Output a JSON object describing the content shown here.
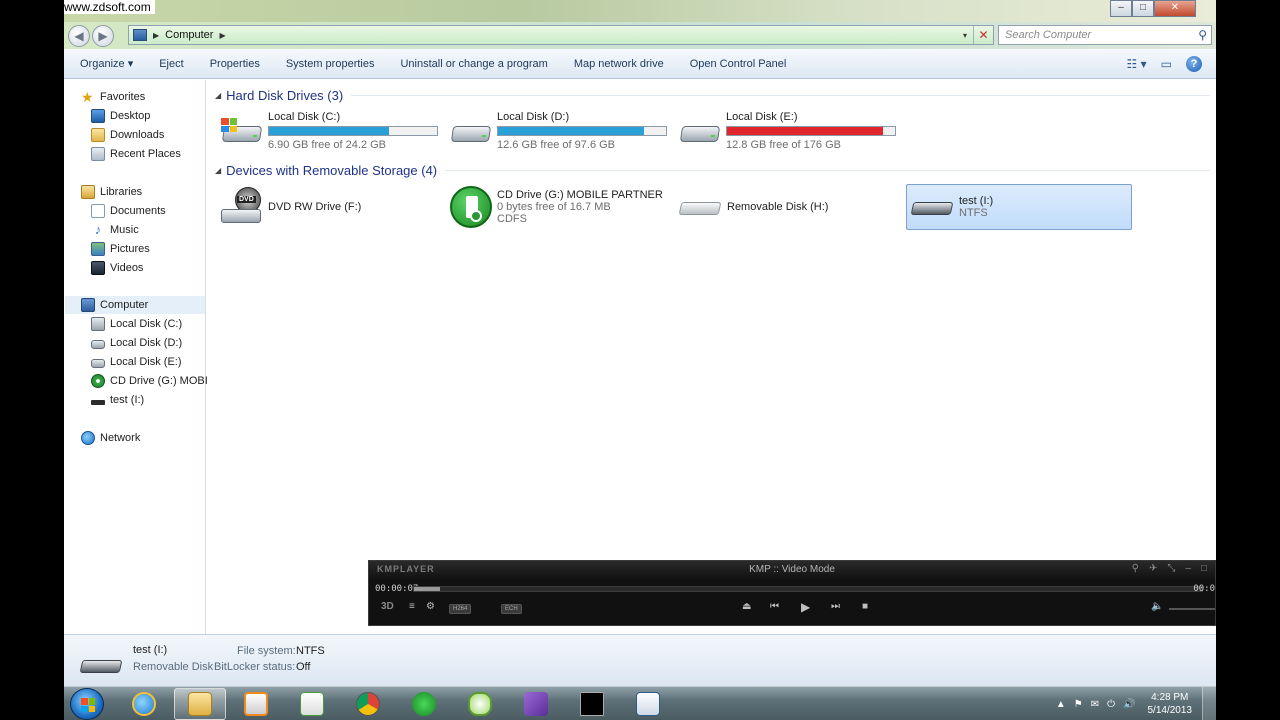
{
  "watermark": "www.zdsoft.com",
  "window_controls": {
    "minimize": "–",
    "maximize": "□",
    "close": "✕"
  },
  "address": {
    "crumb": "Computer",
    "arrow": "▶",
    "dropdown": "▾",
    "clear": "✕"
  },
  "search": {
    "placeholder": "Search Computer",
    "icon": "⚲"
  },
  "nav_buttons": {
    "back": "◀",
    "forward": "▶"
  },
  "toolbar": {
    "items": [
      "Organize ▾",
      "Eject",
      "Properties",
      "System properties",
      "Uninstall or change a program",
      "Map network drive",
      "Open Control Panel"
    ],
    "view_icon": "☷ ▾",
    "preview_icon": "▭",
    "help": "?"
  },
  "nav": {
    "favorites": "Favorites",
    "desktop": "Desktop",
    "downloads": "Downloads",
    "recent": "Recent Places",
    "libraries": "Libraries",
    "documents": "Documents",
    "music": "Music",
    "pictures": "Pictures",
    "videos": "Videos",
    "computer": "Computer",
    "disk_c": "Local Disk (C:)",
    "disk_d": "Local Disk (D:)",
    "disk_e": "Local Disk (E:)",
    "cd_g": "CD Drive (G:) MOBIL",
    "test_i": "test (I:)",
    "network": "Network",
    "music_glyph": "♪",
    "star_glyph": "★"
  },
  "groups": {
    "hdd": "Hard Disk Drives (3)",
    "removable": "Devices with Removable Storage (4)",
    "triangle": "◢"
  },
  "drives": {
    "c": {
      "name": "Local Disk (C:)",
      "free": "6.90 GB free of 24.2 GB",
      "used_fraction": 0.715,
      "bar_color": "#2aa0d8"
    },
    "d": {
      "name": "Local Disk (D:)",
      "free": "12.6 GB free of 97.6 GB",
      "used_fraction": 0.87,
      "bar_color": "#2aa0d8"
    },
    "e": {
      "name": "Local Disk (E:)",
      "free": "12.8 GB free of 176 GB",
      "used_fraction": 0.927,
      "bar_color": "#e0262c"
    }
  },
  "removable": {
    "f": {
      "name": "DVD RW Drive (F:)",
      "badge": "DVD"
    },
    "g": {
      "name": "CD Drive (G:) MOBILE PARTNER",
      "free": "0 bytes free of 16.7 MB",
      "fs": "CDFS"
    },
    "h": {
      "name": "Removable Disk (H:)"
    },
    "i": {
      "name": "test (I:)",
      "fs": "NTFS"
    }
  },
  "details": {
    "name": "test (I:)",
    "type": "Removable Disk",
    "fs_label": "File system:",
    "fs_value": "NTFS",
    "bitlocker_label": "BitLocker status:",
    "bitlocker_value": "Off"
  },
  "kmplayer": {
    "logo": "KMPLAYER",
    "title": "KMP :: Video Mode",
    "time": "00:00:07",
    "time_end": "00:0",
    "progress": 0.033,
    "badge_3d": "3D",
    "pill1": "H264",
    "pill2": "ECH",
    "top_icons": [
      "⚲",
      "✈",
      "⤡",
      "–",
      "□"
    ],
    "controls": {
      "eject": "⏏",
      "prev": "⏮",
      "play": "▶",
      "next": "⏭",
      "stop": "■",
      "menu": "≡",
      "gear": "⚙",
      "volume": "🔈"
    }
  },
  "taskbar": {
    "time": "4:28 PM",
    "date": "5/14/2013",
    "tray_icons": [
      "▲",
      "⚑",
      "✉",
      "⏻",
      "🔊"
    ]
  },
  "colors": {
    "link_blue": "#1e3287",
    "selection": "#c1dcfc",
    "taskbar": "#5f7178"
  }
}
